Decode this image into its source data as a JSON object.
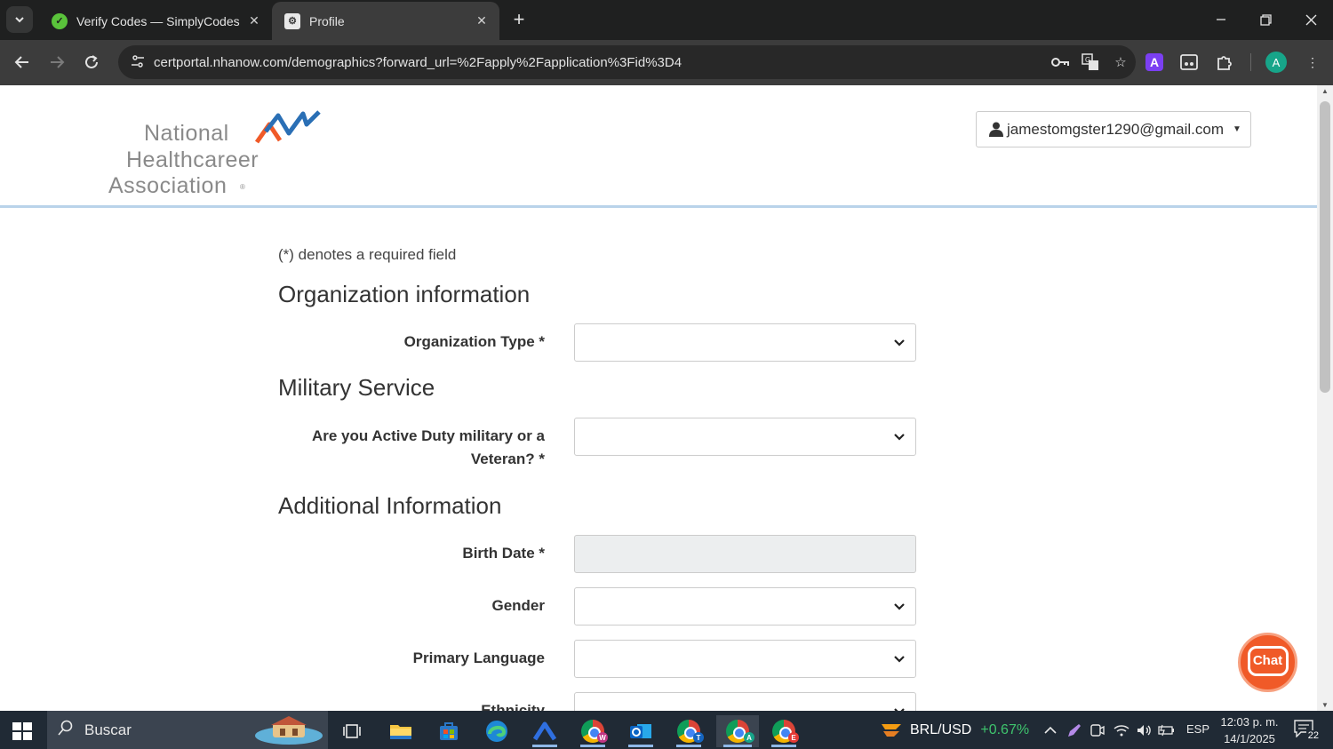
{
  "browser": {
    "tabs": [
      {
        "title": "Verify Codes — SimplyCodes",
        "favicon": "simplycodes-icon",
        "active": false
      },
      {
        "title": "Profile",
        "favicon": "gear-icon",
        "active": true
      }
    ],
    "url": "certportal.nhanow.com/demographics?forward_url=%2Fapply%2Fapplication%3Fid%3D4",
    "profile_initial": "A",
    "extension_letter": "A"
  },
  "header": {
    "logo_lines": [
      "National",
      "Healthcareer",
      "Association"
    ],
    "logo_colors": {
      "text": "#8a8a8a",
      "orange": "#f05a28",
      "blue": "#2a6fb5"
    },
    "user_email": "jamestomgster1290@gmail.com"
  },
  "form": {
    "required_note": "(*) denotes a required field",
    "sections": {
      "organization": "Organization information",
      "military": "Military Service",
      "additional": "Additional Information"
    },
    "labels": {
      "organization_type": "Organization Type *",
      "military": "Are you Active Duty military or a Veteran? *",
      "birth_date": "Birth Date *",
      "gender": "Gender",
      "primary_language": "Primary Language",
      "ethnicity": "Ethnicity"
    },
    "values": {
      "organization_type": "",
      "military": "",
      "birth_date": "",
      "gender": "",
      "primary_language": "",
      "ethnicity": ""
    }
  },
  "chat": {
    "label": "Chat",
    "color": "#f05a28"
  },
  "taskbar": {
    "search_placeholder": "Buscar",
    "ticker_symbol": "BRL/USD",
    "ticker_change": "+0.67%",
    "language": "ESP",
    "time": "12:03 p. m.",
    "date": "14/1/2025",
    "notification_count": "22"
  }
}
